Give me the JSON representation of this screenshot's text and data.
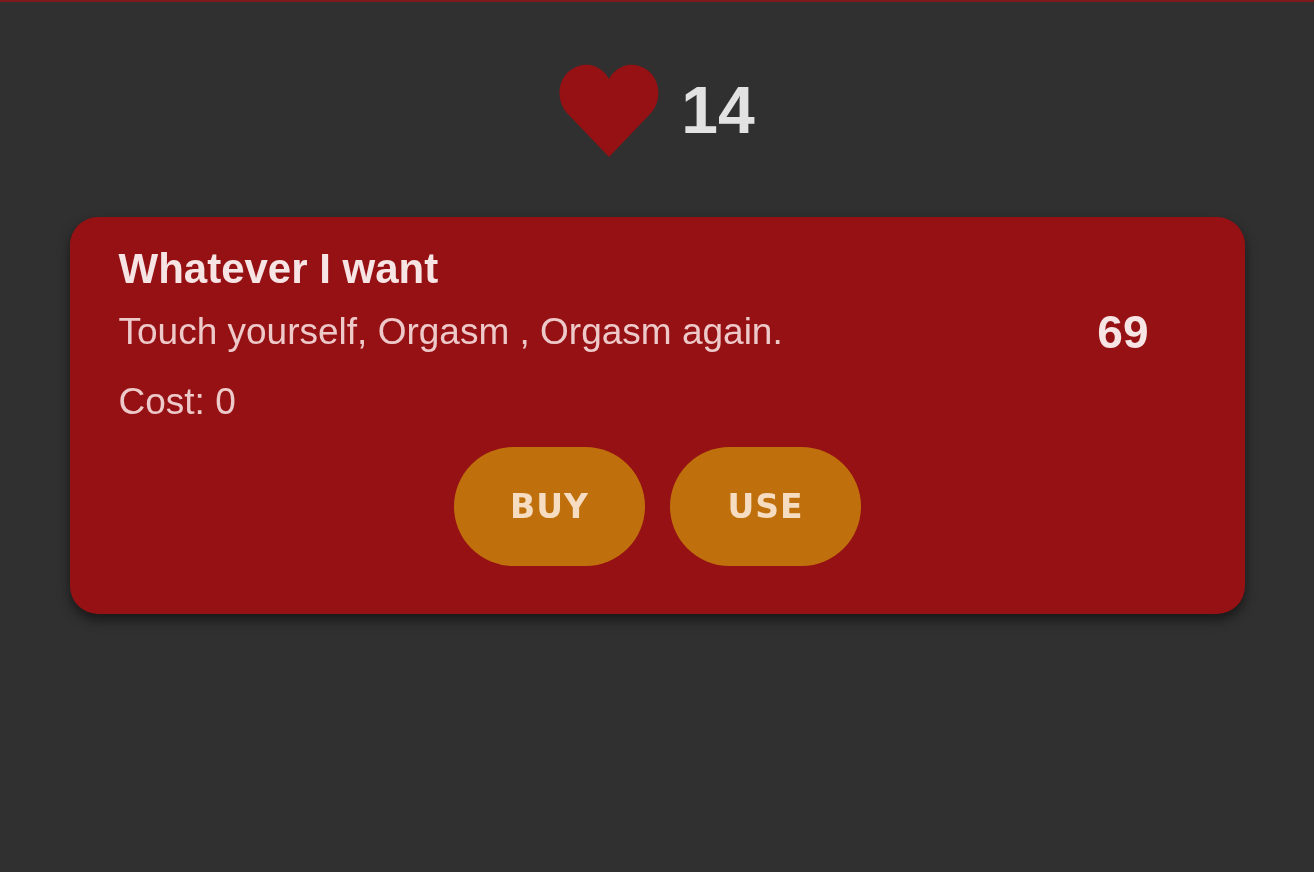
{
  "points": {
    "count": "14"
  },
  "rewards": [
    {
      "title": "Whatever I want",
      "description": "Touch yourself, Orgasm , Orgasm again.",
      "value": "69",
      "cost": "Cost: 0",
      "buttons": [
        "BUY",
        "USE"
      ]
    }
  ]
}
